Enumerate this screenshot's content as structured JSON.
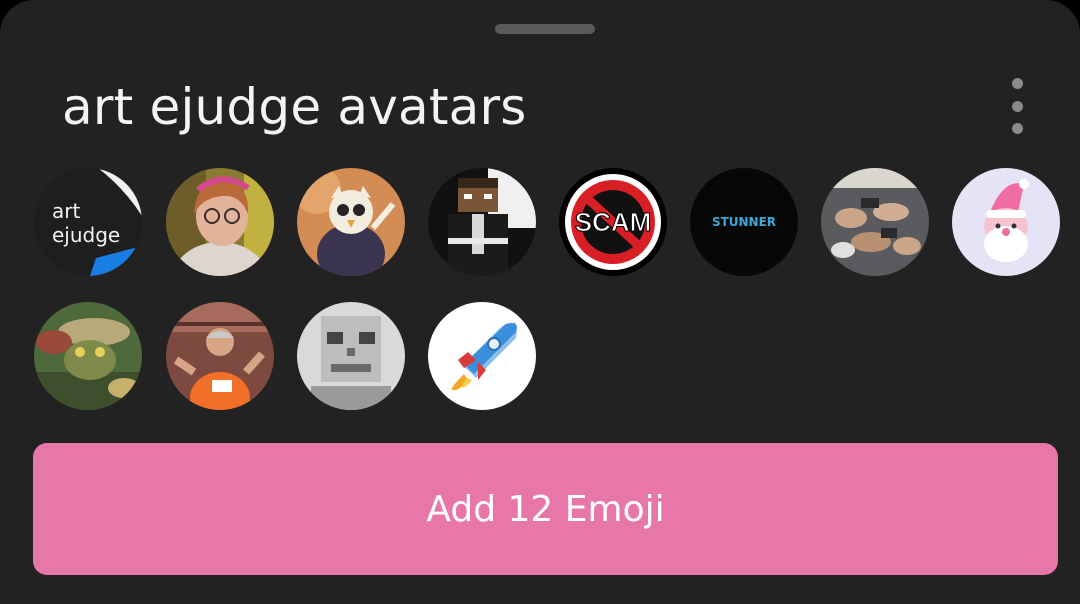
{
  "pack": {
    "title": "art ejudge avatars",
    "menu_icon": "more-vertical-icon"
  },
  "emojis": [
    {
      "name": "art-ejudge-logo",
      "text": [
        "art",
        "ejudge"
      ]
    },
    {
      "name": "girl-with-glasses"
    },
    {
      "name": "cartoon-owl-character"
    },
    {
      "name": "pixel-minecraft-character"
    },
    {
      "name": "no-scam-sign",
      "text": "SCAM"
    },
    {
      "name": "stunner-logo",
      "text": "STUNNER"
    },
    {
      "name": "group-of-hands-photo"
    },
    {
      "name": "pink-santa-toy"
    },
    {
      "name": "frog-warrior-art"
    },
    {
      "name": "man-in-orange-shirt"
    },
    {
      "name": "pixel-skeleton-head"
    },
    {
      "name": "rocket-emoji"
    }
  ],
  "add_button": {
    "label": "Add 12 Emoji"
  },
  "colors": {
    "sheet_bg": "#222223",
    "button_bg": "#e677a8",
    "title": "#f4f4f4"
  }
}
